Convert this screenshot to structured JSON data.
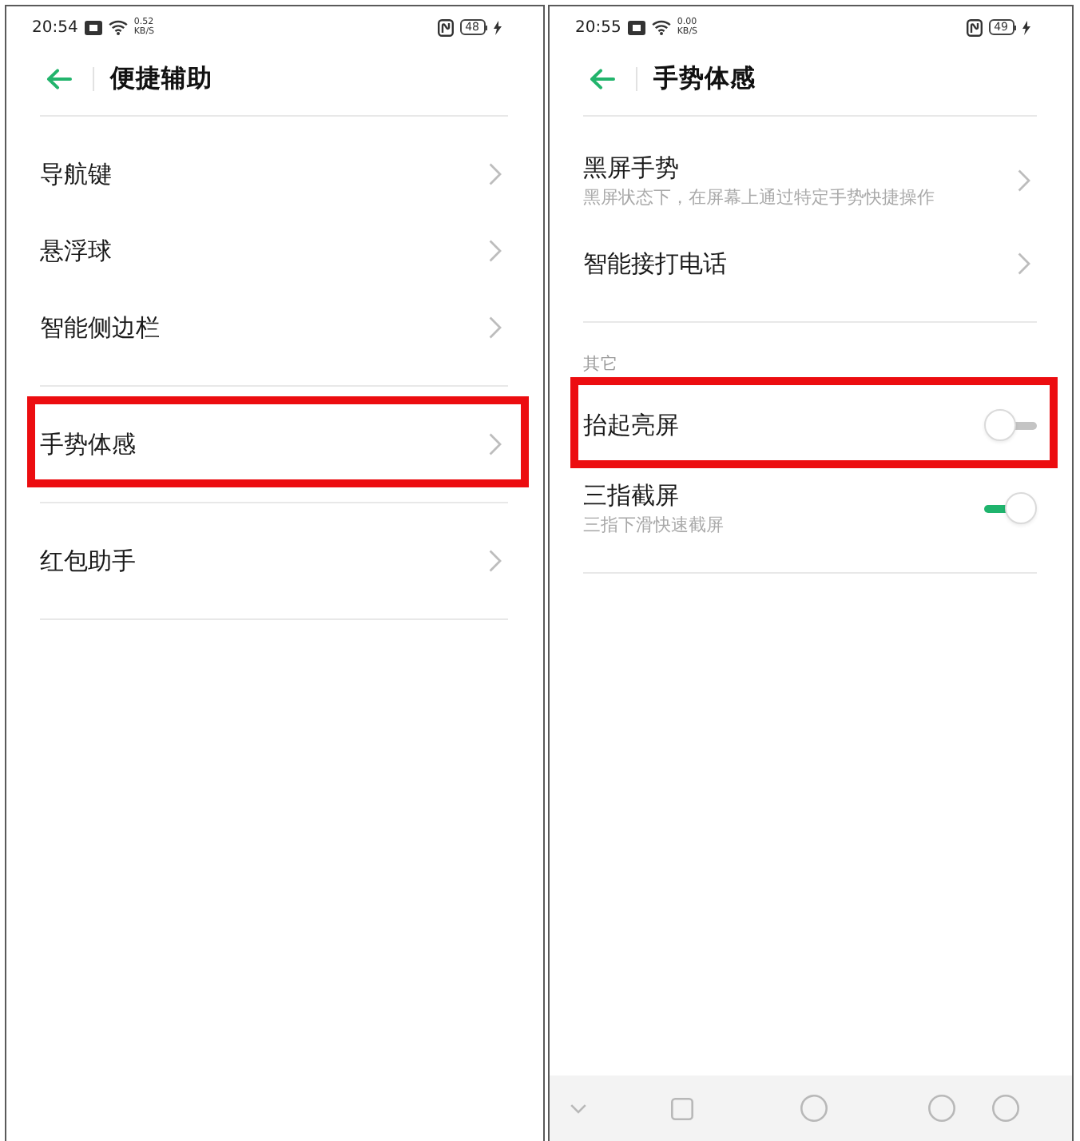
{
  "screens": [
    {
      "status_bar": {
        "time": "20:54",
        "speed_value": "0.52",
        "speed_unit": "KB/S",
        "battery": "48",
        "charging": true
      },
      "header": {
        "title": "便捷辅助"
      },
      "groups": [
        {
          "items": [
            {
              "kind": "link",
              "label": "导航键",
              "highlighted": false
            },
            {
              "kind": "link",
              "label": "悬浮球",
              "highlighted": false
            },
            {
              "kind": "link",
              "label": "智能侧边栏",
              "highlighted": false
            }
          ]
        },
        {
          "items": [
            {
              "kind": "link",
              "label": "手势体感",
              "highlighted": true
            }
          ]
        },
        {
          "items": [
            {
              "kind": "link",
              "label": "红包助手",
              "highlighted": false
            }
          ]
        }
      ]
    },
    {
      "status_bar": {
        "time": "20:55",
        "speed_value": "0.00",
        "speed_unit": "KB/S",
        "battery": "49",
        "charging": true
      },
      "header": {
        "title": "手势体感"
      },
      "groups": [
        {
          "items": [
            {
              "kind": "link",
              "label": "黑屏手势",
              "subtitle": "黑屏状态下，在屏幕上通过特定手势快捷操作",
              "highlighted": false
            },
            {
              "kind": "link",
              "label": "智能接打电话",
              "highlighted": false
            }
          ]
        },
        {
          "title": "其它",
          "items": [
            {
              "kind": "toggle",
              "label": "抬起亮屏",
              "on": false,
              "highlighted": true
            },
            {
              "kind": "toggle",
              "label": "三指截屏",
              "subtitle": "三指下滑快速截屏",
              "on": true,
              "highlighted": false
            }
          ]
        }
      ],
      "nav_bar": [
        {
          "kind": "chevron"
        },
        {
          "kind": "square"
        },
        {
          "kind": "circle"
        },
        {
          "kind": "circle"
        },
        {
          "kind": "circle"
        }
      ]
    }
  ]
}
